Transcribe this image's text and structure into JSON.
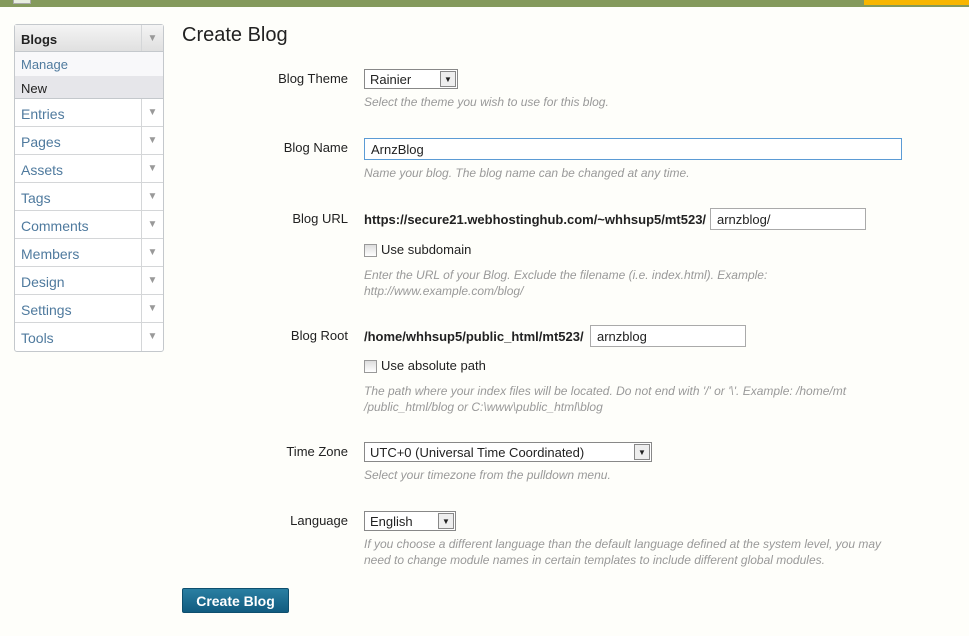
{
  "sidebar": {
    "header": "Blogs",
    "sub": [
      "Manage",
      "New"
    ],
    "items": [
      "Entries",
      "Pages",
      "Assets",
      "Tags",
      "Comments",
      "Members",
      "Design",
      "Settings",
      "Tools"
    ]
  },
  "page_title": "Create Blog",
  "form": {
    "theme": {
      "label": "Blog Theme",
      "value": "Rainier",
      "hint": "Select the theme you wish to use for this blog."
    },
    "name": {
      "label": "Blog Name",
      "value": "ArnzBlog",
      "hint": "Name your blog. The blog name can be changed at any time."
    },
    "url": {
      "label": "Blog URL",
      "prefix": "https://secure21.webhostinghub.com/~whhsup5/mt523/",
      "value": "arnzblog/",
      "checkbox": "Use subdomain",
      "hint": "Enter the URL of your Blog. Exclude the filename (i.e. index.html). Example: http://www.example.com/blog/"
    },
    "root": {
      "label": "Blog Root",
      "prefix": "/home/whhsup5/public_html/mt523/",
      "value": "arnzblog",
      "checkbox": "Use absolute path",
      "hint": "The path where your index files will be located. Do not end with '/' or '\\'. Example: /home/mt /public_html/blog or C:\\www\\public_html\\blog"
    },
    "timezone": {
      "label": "Time Zone",
      "value": "UTC+0 (Universal Time Coordinated)",
      "hint": "Select your timezone from the pulldown menu."
    },
    "language": {
      "label": "Language",
      "value": "English",
      "hint": "If you choose a different language than the default language defined at the system level, you may need to change module names in certain templates to include different global modules."
    }
  },
  "submit": "Create Blog"
}
